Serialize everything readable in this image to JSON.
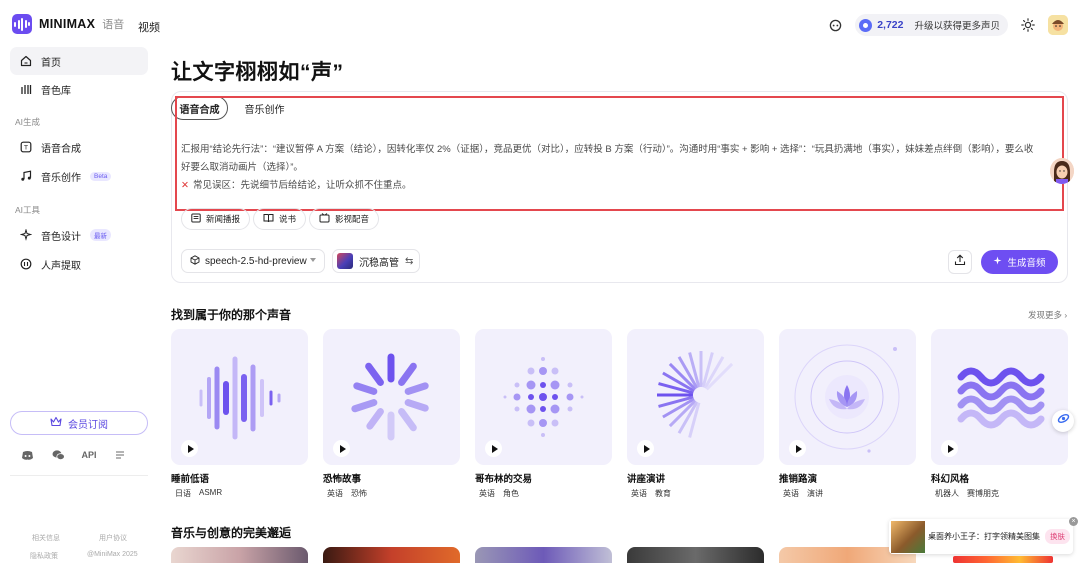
{
  "brand": {
    "name": "MINIMAX",
    "sub": "语音"
  },
  "topnav": {
    "video": "视频"
  },
  "header": {
    "coins": "2,722",
    "upgrade": "升级以获得更多声贝"
  },
  "sidebar": {
    "items": [
      {
        "label": "首页",
        "icon": "home-icon"
      },
      {
        "label": "音色库",
        "icon": "library-icon"
      }
    ],
    "section_ai": "AI生成",
    "ai_items": [
      {
        "label": "语音合成",
        "icon": "speech-icon"
      },
      {
        "label": "音乐创作",
        "badge": "Beta",
        "icon": "music-icon"
      }
    ],
    "section_tools": "AI工具",
    "tool_items": [
      {
        "label": "音色设计",
        "badge": "最新",
        "icon": "voice-design-icon"
      },
      {
        "label": "人声提取",
        "icon": "vocal-extract-icon"
      }
    ],
    "vip": "会员订阅",
    "social": {
      "api": "API"
    },
    "footer": {
      "related": "相关信息",
      "agreement": "用户协议",
      "privacy": "隐私政策",
      "copyright": "@MiniMax 2025"
    }
  },
  "main": {
    "title": "让文字栩栩如“声”",
    "tabs": [
      "语音合成",
      "音乐创作"
    ],
    "editor": {
      "text1": "汇报用“结论先行法”：“建议暂停 A 方案（结论），因转化率仅 2%（证据），竞品更优（对比），应转投 B 方案（行动）”。沟通时用“事实 + 影响 + 选择”：“玩具扔满地（事实），妹妹差点绊倒（影响），要么收好要么取消动画片（选择）”。",
      "text2": "常见误区：先说细节后给结论，让听众抓不住重点。"
    },
    "chips": [
      "新闻播报",
      "说书",
      "影视配音"
    ],
    "model": "speech-2.5-hd-preview",
    "voice": "沉稳高管",
    "generate": "生成音频"
  },
  "voices_section": {
    "title": "找到属于你的那个声音",
    "more": "发现更多 ›",
    "cards": [
      {
        "name": "睡前低语",
        "tags": [
          "日语",
          "ASMR"
        ]
      },
      {
        "name": "恐怖故事",
        "tags": [
          "英语",
          "恐怖"
        ]
      },
      {
        "name": "哥布林的交易",
        "tags": [
          "英语",
          "角色"
        ]
      },
      {
        "name": "讲座演讲",
        "tags": [
          "英语",
          "教育"
        ]
      },
      {
        "name": "推销路演",
        "tags": [
          "英语",
          "演讲"
        ]
      },
      {
        "name": "科幻风格",
        "tags": [
          "机器人",
          "赛博朋克"
        ]
      }
    ]
  },
  "music_section": {
    "title": "音乐与创意的完美邂逅"
  },
  "ad": {
    "text": "桌面养小王子：打字领精美图集",
    "button": "换肤"
  },
  "colors": {
    "accent": "#6e4ef2",
    "highlight": "#e4474e"
  }
}
